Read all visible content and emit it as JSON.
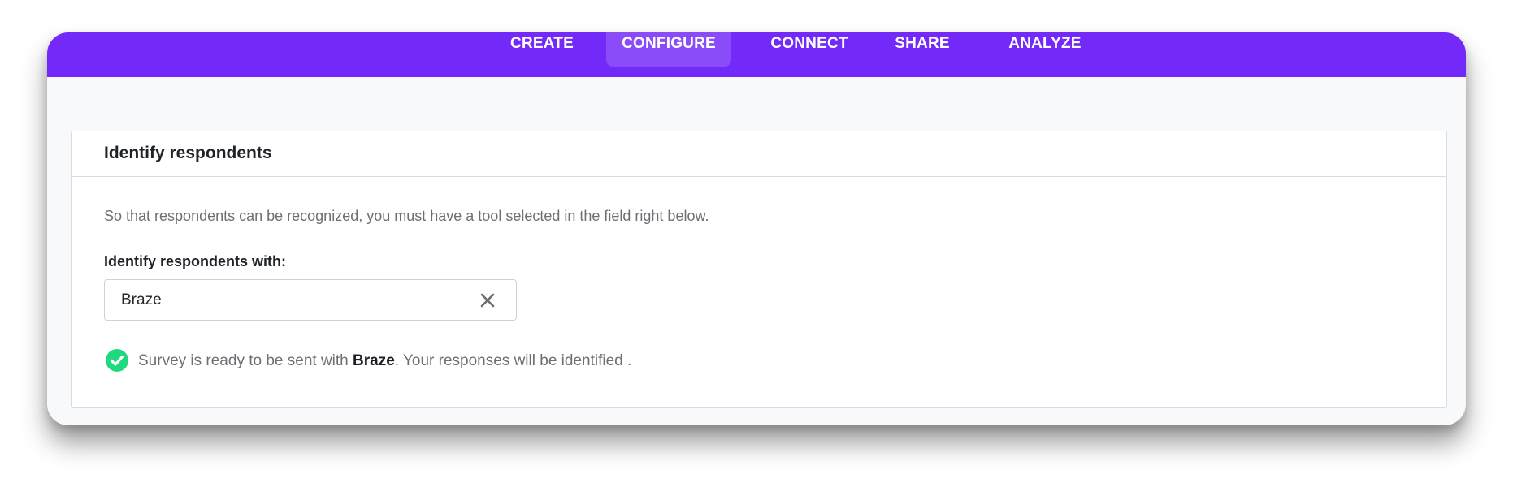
{
  "nav": {
    "tabs": [
      {
        "label": "CREATE",
        "active": false
      },
      {
        "label": "CONFIGURE",
        "active": true
      },
      {
        "label": "CONNECT",
        "active": false
      },
      {
        "label": "SHARE",
        "active": false
      },
      {
        "label": "ANALYZE",
        "active": false
      }
    ]
  },
  "card": {
    "title": "Identify respondents",
    "description": "So that respondents can be recognized, you must have a tool selected in the field right below.",
    "field_label": "Identify respondents with:",
    "select": {
      "value": "Braze",
      "clear_icon": "close-icon"
    },
    "status": {
      "icon": "check-circle-icon",
      "prefix": "Survey is ready to be sent with ",
      "tool": "Braze",
      "suffix": ". Your responses will be identified ."
    }
  },
  "colors": {
    "brand": "#7329f7",
    "tab_active": "#8a4cf9",
    "success": "#1ed97d",
    "page_bg": "#f8f9fa"
  }
}
